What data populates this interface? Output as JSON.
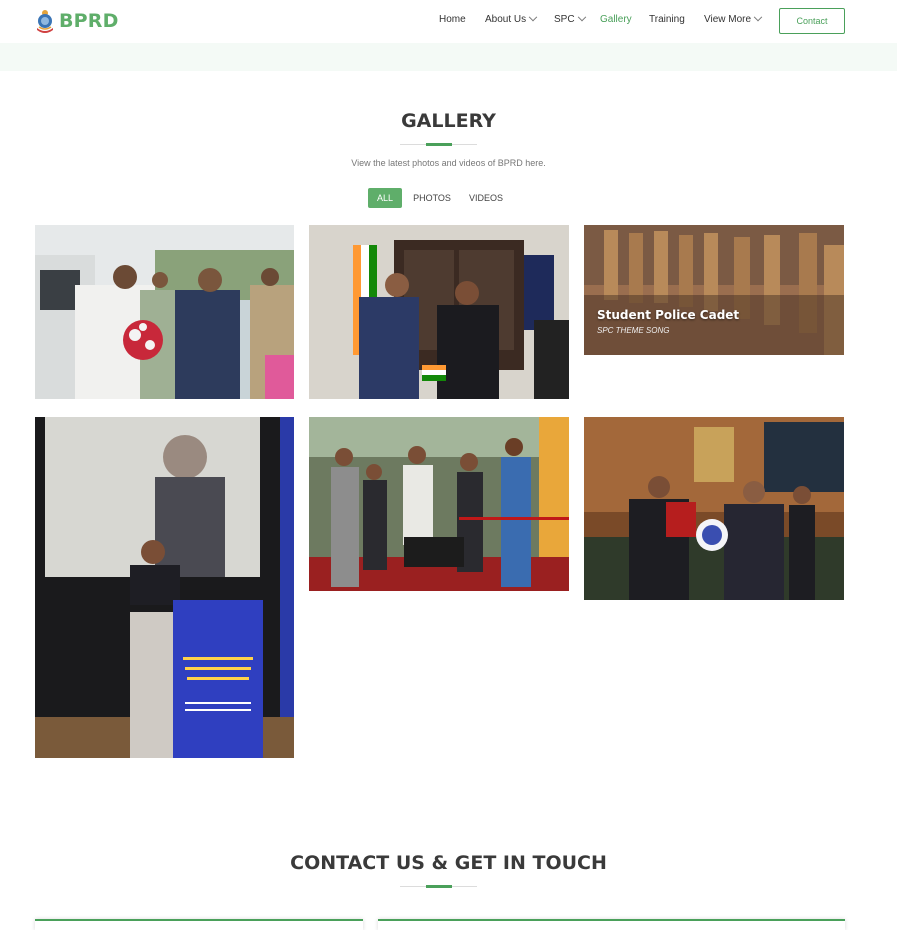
{
  "brand": {
    "name": "BPRD",
    "emblem_icon": "bprd-emblem-icon",
    "accent_color": "#4aa05a"
  },
  "nav": {
    "items": [
      {
        "label": "Home",
        "active": false,
        "has_dropdown": false
      },
      {
        "label": "About Us",
        "active": false,
        "has_dropdown": true
      },
      {
        "label": "SPC",
        "active": false,
        "has_dropdown": true
      },
      {
        "label": "Gallery",
        "active": true,
        "has_dropdown": false
      },
      {
        "label": "Training",
        "active": false,
        "has_dropdown": false
      },
      {
        "label": "View More",
        "active": false,
        "has_dropdown": true
      }
    ],
    "contact_label": "Contact"
  },
  "gallery": {
    "title": "GALLERY",
    "subtitle": "View the latest photos and videos of BPRD here.",
    "filters": [
      {
        "label": "ALL",
        "active": true
      },
      {
        "label": "PHOTOS",
        "active": false
      },
      {
        "label": "VIDEOS",
        "active": false
      }
    ],
    "items": [
      {
        "type": "photo"
      },
      {
        "type": "photo"
      },
      {
        "type": "video",
        "title": "Student Police Cadet",
        "subtitle": "SPC THEME SONG"
      },
      {
        "type": "photo"
      },
      {
        "type": "photo"
      },
      {
        "type": "photo"
      }
    ]
  },
  "contact": {
    "title": "CONTACT US & GET IN TOUCH"
  }
}
